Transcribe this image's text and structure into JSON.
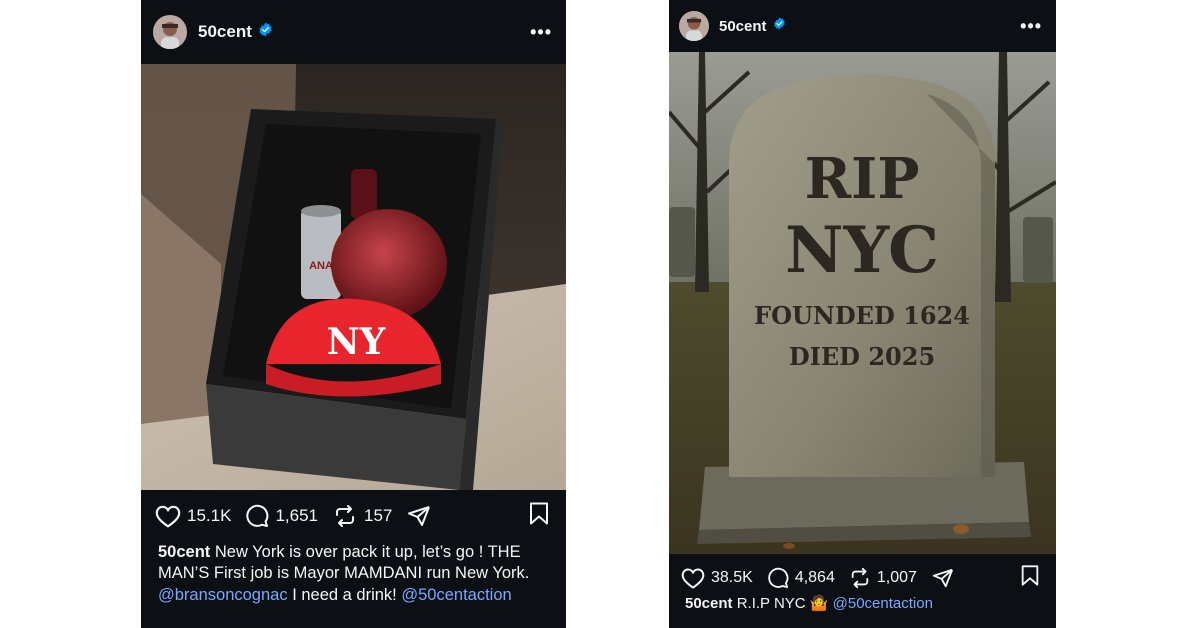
{
  "posts": [
    {
      "username": "50cent",
      "more_icon": "more-horizontal-icon",
      "likes": "15.1K",
      "comments": "1,651",
      "reposts": "157",
      "caption_user": "50cent",
      "caption_text": "New York is over pack it up, let’s go ! THE MAN’S First job is Mayor MAMDANI run New York.",
      "mention_1": "@bransoncognac",
      "caption_text_2": "I need a drink!",
      "mention_2": "@50centaction",
      "image_labels": {
        "cap_logo": "NY",
        "can_text": "ANA"
      }
    },
    {
      "username": "50cent",
      "more_icon": "more-horizontal-icon",
      "likes": "38.5K",
      "comments": "4,864",
      "reposts": "1,007",
      "caption_user": "50cent",
      "caption_text": "R.I.P NYC 🤷",
      "mention_1": "@50centaction",
      "image_labels": {
        "line1": "RIP",
        "line2": "NYC",
        "line3": "FOUNDED 1624",
        "line4": "DIED 2025"
      }
    }
  ],
  "colors": {
    "background": "#0c1014",
    "accent": "#0095f6",
    "mention": "#7aa7ff",
    "cap_red": "#e8242d"
  }
}
